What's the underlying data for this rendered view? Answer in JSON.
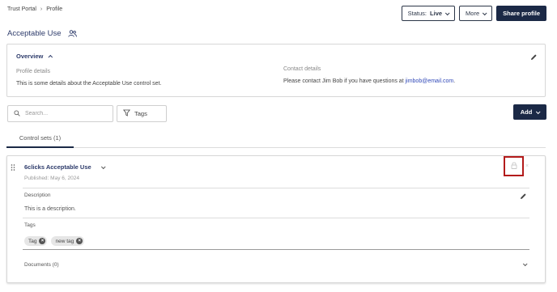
{
  "breadcrumb": {
    "items": [
      "Trust Portal",
      "Profile"
    ]
  },
  "header": {
    "status_label": "Status:",
    "status_value": "Live",
    "more_label": "More",
    "share_label": "Share profile"
  },
  "page": {
    "title": "Acceptable Use",
    "title_icon": "users-icon"
  },
  "overview": {
    "title": "Overview",
    "profile_details_label": "Profile details",
    "profile_details_text": "This is some details about the Acceptable Use control set.",
    "contact_details_label": "Contact details",
    "contact_text": "Please contact Jim Bob if you have questions at",
    "contact_email": "jimbob@email.com",
    "contact_suffix": "."
  },
  "toolbar": {
    "search_placeholder": "Search...",
    "tags_label": "Tags",
    "add_label": "Add"
  },
  "tabs": [
    {
      "label": "Control sets (1)",
      "active": true
    }
  ],
  "control_set": {
    "title": "6clicks Acceptable Use",
    "published": "Published: May 6, 2024",
    "description_label": "Description",
    "description_text": "This is a description.",
    "tags_label": "Tags",
    "tags": [
      "Tag",
      "new tag"
    ],
    "documents_label": "Documents (0)"
  },
  "colors": {
    "primary": "#1b2946",
    "title": "#2c3a6a",
    "link": "#3048b8",
    "highlight": "#b31b1b"
  }
}
